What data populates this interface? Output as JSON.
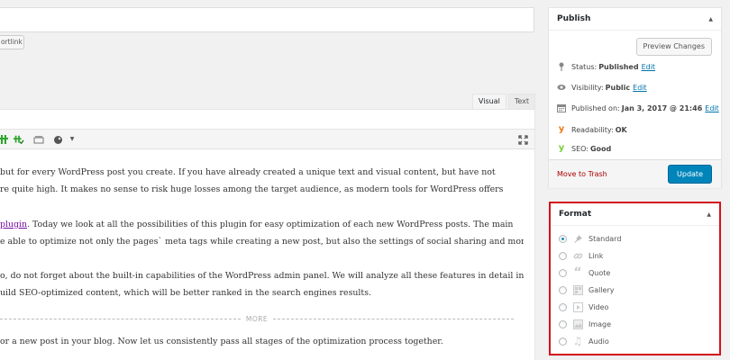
{
  "editor": {
    "shortlink_label": "ortlink",
    "tabs": [
      {
        "label": "Visual"
      },
      {
        "label": "Text"
      }
    ],
    "more_label": "MORE",
    "paragraphs": [
      {
        "lines": [
          "but for every WordPress post you create. If you have already created a unique text and visual content, but have not",
          "re quite high. It makes no sense to risk huge losses among the target audience, as modern tools for WordPress offers"
        ]
      },
      {
        "link": "plugin",
        "lines": [
          ". Today we look at all the possibilities of this plugin for easy optimization of each new WordPress posts. The main",
          "e able to optimize not only the pages` meta tags while creating a new post, but also the settings of social sharing and more"
        ]
      },
      {
        "lines": [
          "o, do not forget about the built-in capabilities of the WordPress admin panel. We will analyze all these features in detail in",
          "uild SEO-optimized content, which will be better ranked in the search engines results."
        ]
      },
      {
        "lines": [
          "or a new post in your blog. Now let us consistently pass all stages of the optimization process together."
        ]
      }
    ]
  },
  "publish": {
    "title": "Publish",
    "preview_label": "Preview Changes",
    "status_label": "Status:",
    "status_value": "Published",
    "visibility_label": "Visibility:",
    "visibility_value": "Public",
    "published_label": "Published on:",
    "published_value": "Jan 3, 2017 @ 21:46",
    "edit_label": "Edit",
    "readability_label": "Readability:",
    "readability_value": "OK",
    "seo_label": "SEO:",
    "seo_value": "Good",
    "trash_label": "Move to Trash",
    "update_label": "Update",
    "colors": {
      "yoast_orange": "#ee7c1b",
      "yoast_green": "#7ad03a",
      "primary": "#0085ba",
      "trash": "#aa0000"
    }
  },
  "format": {
    "title": "Format",
    "highlight_color": "#d3131a",
    "options": [
      {
        "label": "Standard",
        "icon": "pin-icon",
        "checked": true
      },
      {
        "label": "Link",
        "icon": "link-icon",
        "checked": false
      },
      {
        "label": "Quote",
        "icon": "quote-icon",
        "checked": false
      },
      {
        "label": "Gallery",
        "icon": "gallery-icon",
        "checked": false
      },
      {
        "label": "Video",
        "icon": "video-icon",
        "checked": false
      },
      {
        "label": "Image",
        "icon": "image-icon",
        "checked": false
      },
      {
        "label": "Audio",
        "icon": "audio-icon",
        "checked": false
      }
    ]
  }
}
